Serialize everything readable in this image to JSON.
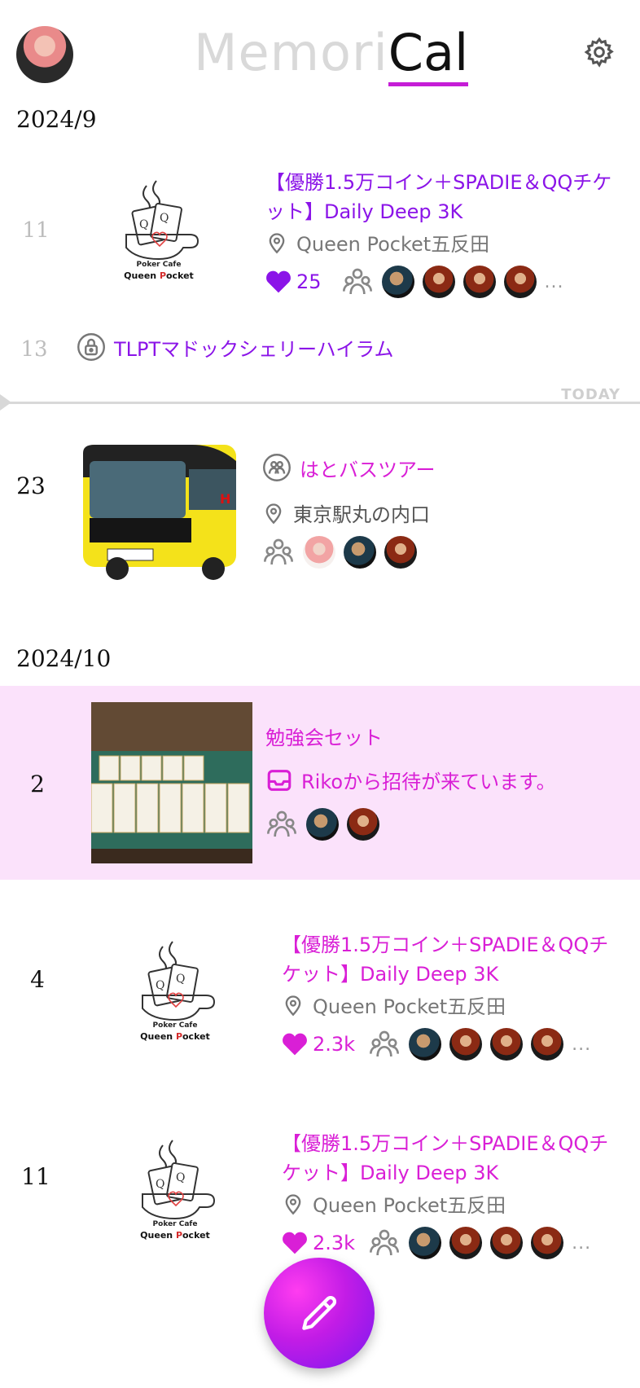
{
  "header": {
    "logo_part1": "Memori",
    "logo_part2": "Cal",
    "avatar_icon": "user-avatar",
    "settings_icon": "gear-icon"
  },
  "today_label": "TODAY",
  "sections": [
    {
      "month": "2024/9",
      "events": [
        {
          "day": "11",
          "title": "【優勝1.5万コイン＋SPADIE＆QQチケット】Daily Deep 3K",
          "location": "Queen Pocket五反田",
          "likes": "25",
          "more": "..."
        },
        {
          "day": "13",
          "title": "TLPTマドックシェリーハイラム"
        },
        {
          "day": "23",
          "title": "はとバスツアー",
          "location": "東京駅丸の内口"
        }
      ]
    },
    {
      "month": "2024/10",
      "events": [
        {
          "day": "2",
          "title": "勉強会セット",
          "invite": "Rikoから招待が来ています。"
        },
        {
          "day": "4",
          "title": "【優勝1.5万コイン＋SPADIE＆QQチケット】Daily Deep 3K",
          "location": "Queen Pocket五反田",
          "likes": "2.3k",
          "more": "..."
        },
        {
          "day": "11",
          "title": "【優勝1.5万コイン＋SPADIE＆QQチケット】Daily Deep 3K",
          "location": "Queen Pocket五反田",
          "likes": "2.3k",
          "more": "..."
        }
      ]
    }
  ],
  "logo_card": {
    "line1": "Poker Cafe",
    "line2a": "Queen ",
    "line2b": "P",
    "line2c": "ocket"
  },
  "colors": {
    "accent_purple": "#8b14e8",
    "accent_magenta": "#d91fd6",
    "highlight_bg": "#fbe2fb"
  },
  "fab_icon": "pencil-icon"
}
